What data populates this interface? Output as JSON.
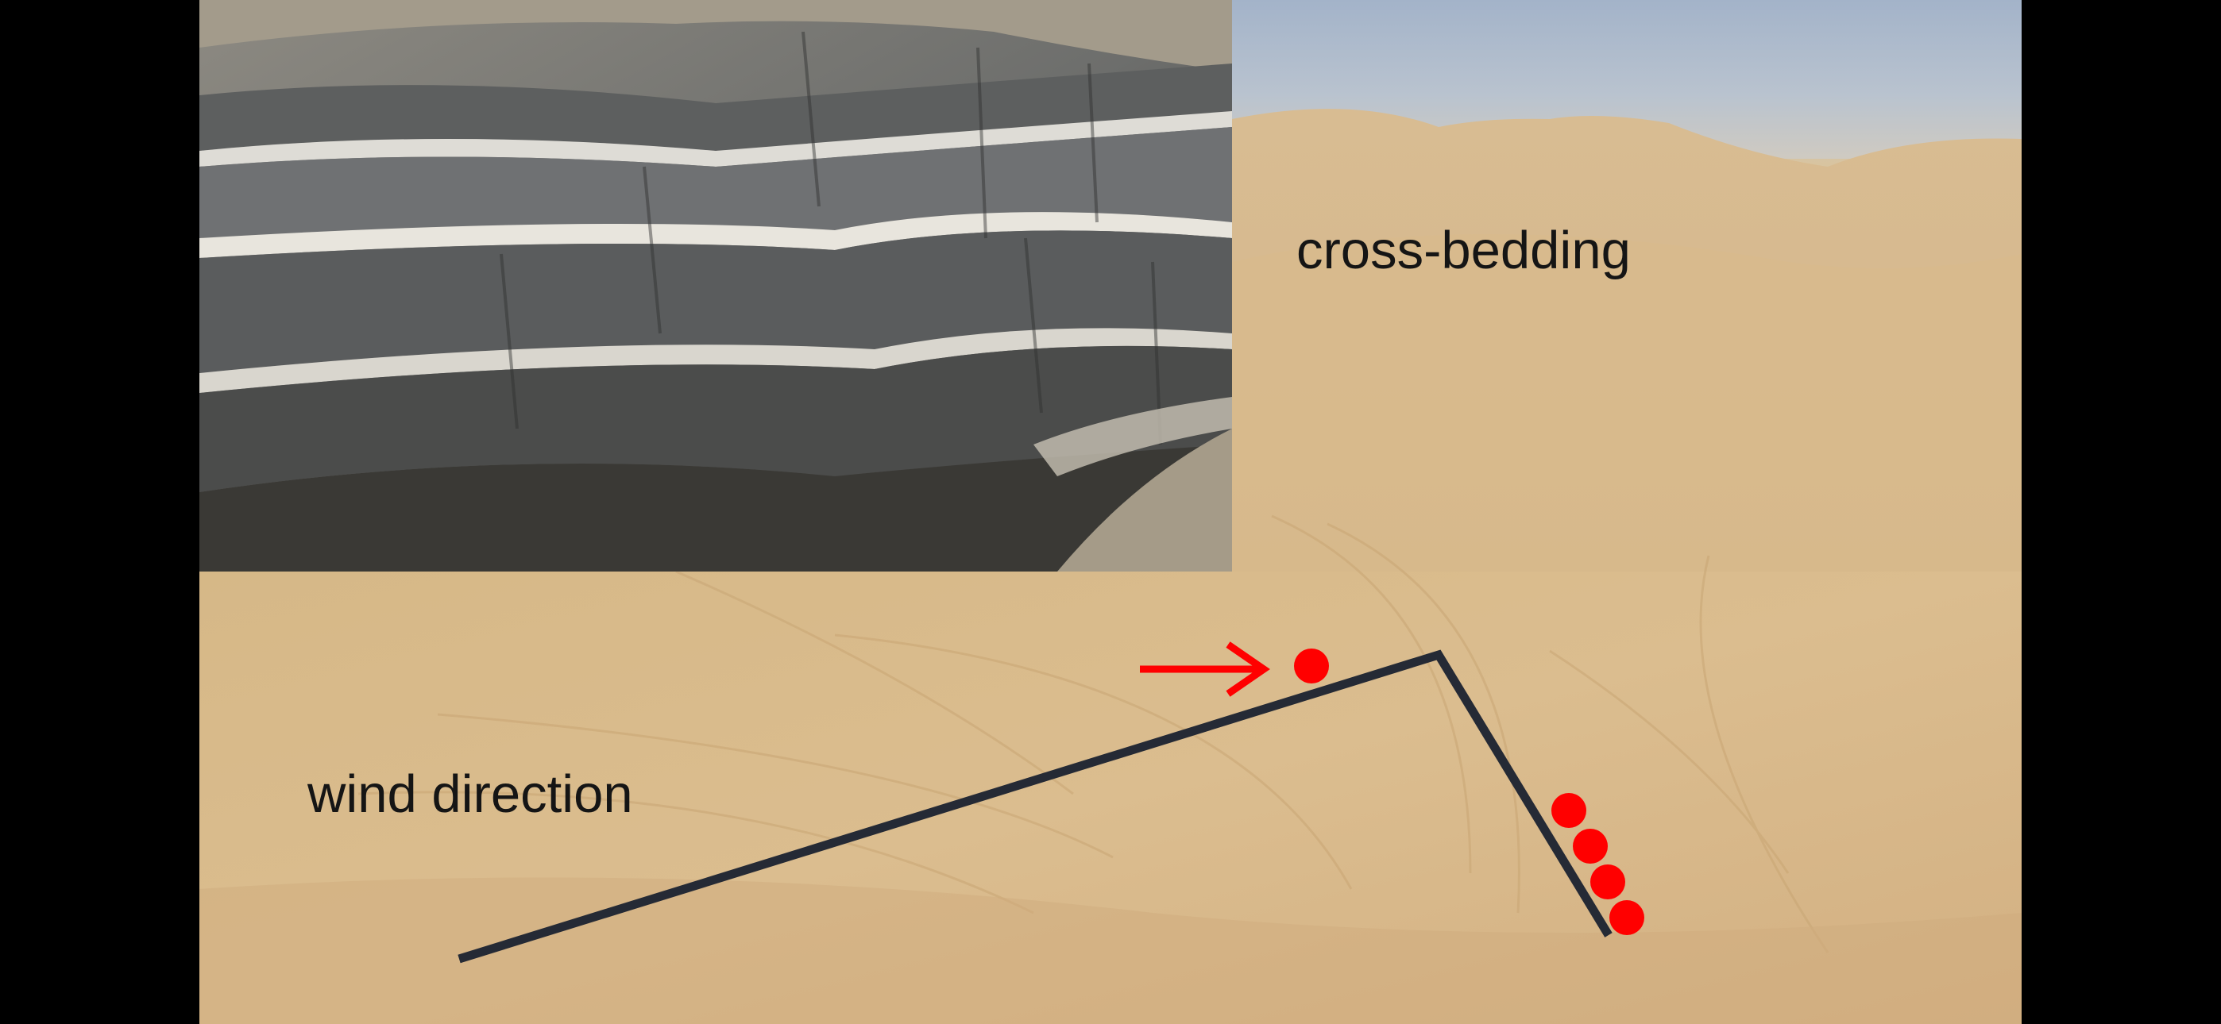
{
  "slide": {
    "labels": {
      "cross_bedding": "cross-bedding",
      "wind_direction": "wind direction"
    },
    "photos": {
      "top_left": "layered-sandstone-cliff-photo",
      "background": "sand-dune-field-photo"
    },
    "diagram": {
      "dune_profile": "dune-cross-section-outline",
      "wind_arrow": "red-arrow-icon",
      "sand_grain_top": "red-circle",
      "sand_grains_slope": [
        "red-circle",
        "red-circle",
        "red-circle",
        "red-circle"
      ]
    },
    "colors": {
      "accent": "#ff0000",
      "line": "#252a35",
      "text": "#151515",
      "sand": "#d9bc8e",
      "sky": "#a3b3c9",
      "rock": "#6c6d6b"
    }
  }
}
